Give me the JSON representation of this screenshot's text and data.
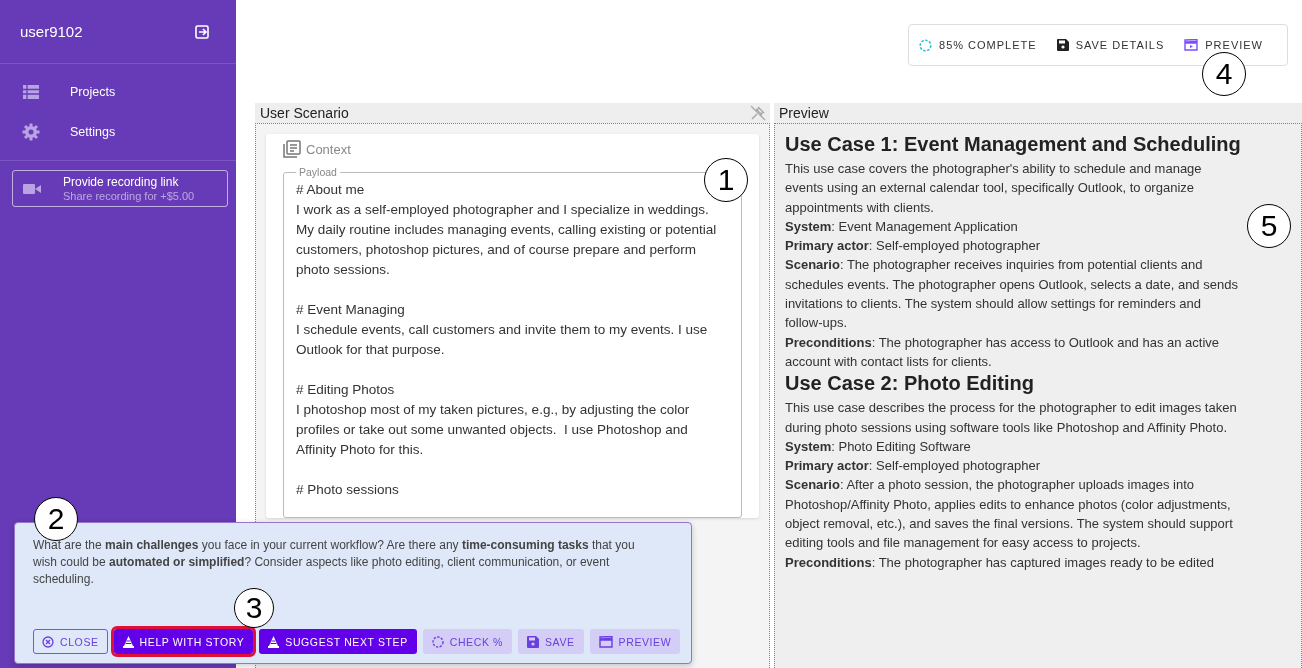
{
  "sidebar": {
    "username": "user9102",
    "nav": [
      {
        "label": "Projects"
      },
      {
        "label": "Settings"
      }
    ],
    "recording_link": {
      "title": "Provide recording link",
      "subtitle": "Share recording for +$5.00"
    }
  },
  "toolbar": {
    "progress": "85% COMPLETE",
    "items": [
      "SAVE DETAILS",
      "PREVIEW"
    ]
  },
  "scenario_panel": {
    "title": "User Scenario",
    "section": "Context",
    "field_label": "Payload",
    "value": "# About me\nI work as a self-employed photographer and I specialize in weddings. My daily routine includes managing events, calling existing or potential customers, photoshop pictures, and of course prepare and perform photo sessions.\n\n# Event Managing\nI schedule events, call customers and invite them to my events. I use Outlook for that purpose.\n\n# Editing Photos\nI photoshop most of my taken pictures, e.g., by adjusting the color profiles or take out some unwanted objects.  I use Photoshop and Affinity Photo for this.\n\n# Photo sessions"
  },
  "preview_panel": {
    "title": "Preview",
    "blocks": [
      {
        "kind": "heading",
        "text": "Use Case 1: Event Management and Scheduling"
      },
      {
        "kind": "paragraph",
        "text": "This use case covers the photographer's ability to schedule and manage events using an external calendar tool, specifically Outlook, to organize appointments with clients."
      },
      {
        "kind": "paragraph",
        "text": "**System**: Event Management Application"
      },
      {
        "kind": "paragraph",
        "text": "**Primary actor**: Self-employed photographer"
      },
      {
        "kind": "paragraph",
        "text": "**Scenario**: The photographer receives inquiries from potential clients and schedules events. The photographer opens Outlook, selects a date, and sends invitations to clients. The system should allow settings for reminders and follow-ups."
      },
      {
        "kind": "paragraph",
        "text": "**Preconditions**: The photographer has access to Outlook and has an active account with contact lists for clients."
      },
      {
        "kind": "heading",
        "text": "Use Case 2: Photo Editing"
      },
      {
        "kind": "paragraph",
        "text": "This use case describes the process for the photographer to edit images taken during photo sessions using software tools like Photoshop and Affinity Photo."
      },
      {
        "kind": "paragraph",
        "text": "**System**: Photo Editing Software"
      },
      {
        "kind": "paragraph",
        "text": "**Primary actor**: Self-employed photographer"
      },
      {
        "kind": "paragraph",
        "text": "**Scenario**: After a photo session, the photographer uploads images into Photoshop/Affinity Photo, applies edits to enhance photos (color adjustments, object removal, etc.), and saves the final versions. The system should support editing tools and file management for easy access to projects."
      },
      {
        "kind": "paragraph",
        "text": "**Preconditions**: The photographer has captured images ready to be edited"
      }
    ]
  },
  "prompt": {
    "text": "What are the **main challenges** you face in your current workflow? Are there any **time-consuming tasks** that you wish could be **automated or simplified**? Consider aspects like photo editing, client communication, or event scheduling.",
    "buttons": [
      {
        "label": "CLOSE",
        "kind": "outlined",
        "highlighted": false
      },
      {
        "label": "HELP WITH STORY",
        "kind": "filled",
        "highlighted": true
      },
      {
        "label": "SUGGEST NEXT STEP",
        "kind": "filled",
        "highlighted": false
      },
      {
        "label": "CHECK %",
        "kind": "tonal",
        "highlighted": false
      },
      {
        "label": "SAVE",
        "kind": "tonal",
        "highlighted": false
      },
      {
        "label": "PREVIEW",
        "kind": "tonal",
        "highlighted": false
      }
    ]
  },
  "annotations": [
    {
      "label": "1"
    },
    {
      "label": "2"
    },
    {
      "label": "3"
    },
    {
      "label": "4"
    },
    {
      "label": "5"
    }
  ]
}
